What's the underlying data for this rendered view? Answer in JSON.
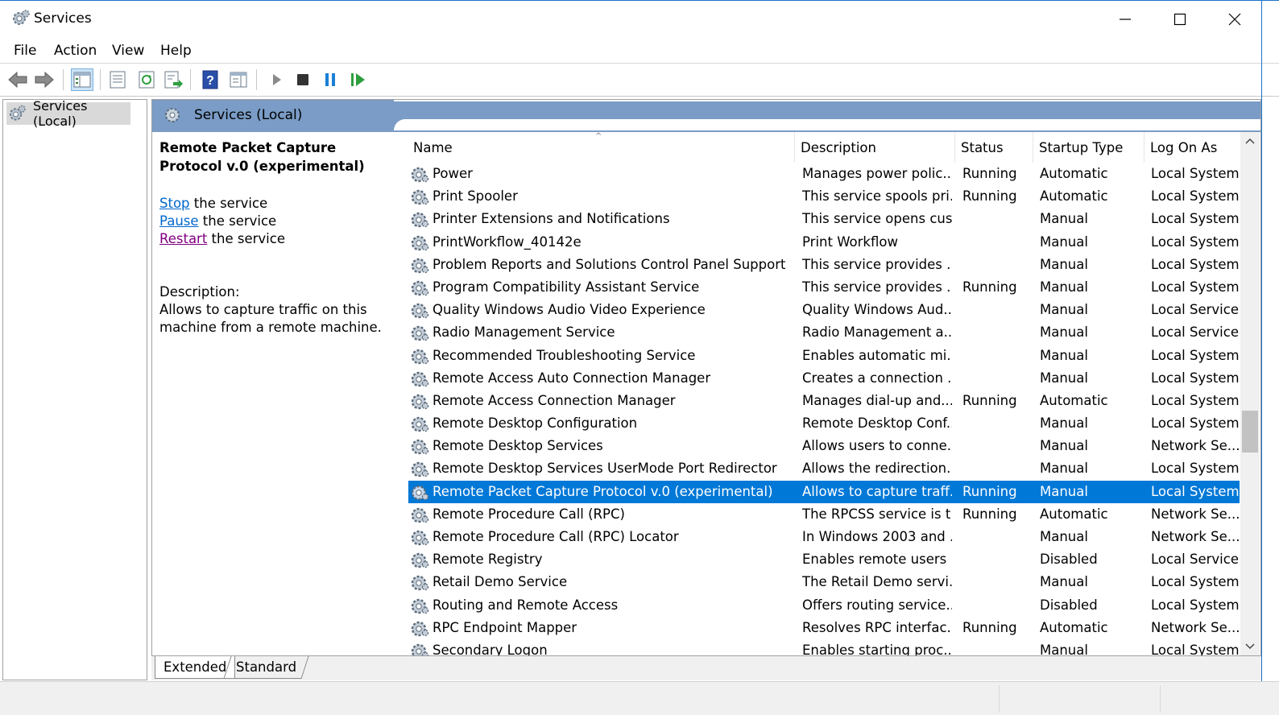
{
  "window": {
    "title": "Services",
    "icon": "services-gear-icon"
  },
  "menu": {
    "items": [
      "File",
      "Action",
      "View",
      "Help"
    ]
  },
  "toolbar": {
    "icons": [
      "back-arrow-icon",
      "forward-arrow-icon",
      "show-hide-console-tree-icon",
      "properties-icon",
      "refresh-icon",
      "export-list-icon",
      "help-icon",
      "show-action-pane-icon",
      "start-service-icon",
      "stop-service-icon",
      "pause-service-icon",
      "restart-service-icon"
    ]
  },
  "tree": {
    "item": "Services (Local)"
  },
  "pane": {
    "header": "Services (Local)"
  },
  "details": {
    "title": "Remote Packet Capture Protocol v.0 (experimental)",
    "actions": [
      {
        "link": "Stop",
        "rest": " the service"
      },
      {
        "link": "Pause",
        "rest": " the service"
      },
      {
        "link": "Restart",
        "rest": " the service"
      }
    ],
    "description_label": "Description:",
    "description_text": "Allows to capture traffic on this machine from a remote machine."
  },
  "table": {
    "columns": [
      "Name",
      "Description",
      "Status",
      "Startup Type",
      "Log On As"
    ],
    "rows": [
      {
        "name": "Power",
        "description": "Manages power polic...",
        "status": "Running",
        "startup": "Automatic",
        "logon": "Local System"
      },
      {
        "name": "Print Spooler",
        "description": "This service spools pri...",
        "status": "Running",
        "startup": "Automatic",
        "logon": "Local System"
      },
      {
        "name": "Printer Extensions and Notifications",
        "description": "This service opens cus...",
        "status": "",
        "startup": "Manual",
        "logon": "Local System"
      },
      {
        "name": "PrintWorkflow_40142e",
        "description": "Print Workflow",
        "status": "",
        "startup": "Manual",
        "logon": "Local System"
      },
      {
        "name": "Problem Reports and Solutions Control Panel Support",
        "description": "This service provides ...",
        "status": "",
        "startup": "Manual",
        "logon": "Local System"
      },
      {
        "name": "Program Compatibility Assistant Service",
        "description": "This service provides ...",
        "status": "Running",
        "startup": "Manual",
        "logon": "Local System"
      },
      {
        "name": "Quality Windows Audio Video Experience",
        "description": "Quality Windows Aud...",
        "status": "",
        "startup": "Manual",
        "logon": "Local Service"
      },
      {
        "name": "Radio Management Service",
        "description": "Radio Management a...",
        "status": "",
        "startup": "Manual",
        "logon": "Local Service"
      },
      {
        "name": "Recommended Troubleshooting Service",
        "description": "Enables automatic mi...",
        "status": "",
        "startup": "Manual",
        "logon": "Local System"
      },
      {
        "name": "Remote Access Auto Connection Manager",
        "description": "Creates a connection ...",
        "status": "",
        "startup": "Manual",
        "logon": "Local System"
      },
      {
        "name": "Remote Access Connection Manager",
        "description": "Manages dial-up and...",
        "status": "Running",
        "startup": "Automatic",
        "logon": "Local System"
      },
      {
        "name": "Remote Desktop Configuration",
        "description": "Remote Desktop Conf...",
        "status": "",
        "startup": "Manual",
        "logon": "Local System"
      },
      {
        "name": "Remote Desktop Services",
        "description": "Allows users to conne...",
        "status": "",
        "startup": "Manual",
        "logon": "Network Se..."
      },
      {
        "name": "Remote Desktop Services UserMode Port Redirector",
        "description": "Allows the redirection...",
        "status": "",
        "startup": "Manual",
        "logon": "Local System"
      },
      {
        "name": "Remote Packet Capture Protocol v.0 (experimental)",
        "description": "Allows to capture traff...",
        "status": "Running",
        "startup": "Manual",
        "logon": "Local System",
        "selected": true
      },
      {
        "name": "Remote Procedure Call (RPC)",
        "description": "The RPCSS service is t...",
        "status": "Running",
        "startup": "Automatic",
        "logon": "Network Se..."
      },
      {
        "name": "Remote Procedure Call (RPC) Locator",
        "description": "In Windows 2003 and ...",
        "status": "",
        "startup": "Manual",
        "logon": "Network Se..."
      },
      {
        "name": "Remote Registry",
        "description": "Enables remote users ...",
        "status": "",
        "startup": "Disabled",
        "logon": "Local Service"
      },
      {
        "name": "Retail Demo Service",
        "description": "The Retail Demo servi...",
        "status": "",
        "startup": "Manual",
        "logon": "Local System"
      },
      {
        "name": "Routing and Remote Access",
        "description": "Offers routing service...",
        "status": "",
        "startup": "Disabled",
        "logon": "Local System"
      },
      {
        "name": "RPC Endpoint Mapper",
        "description": "Resolves RPC interfac...",
        "status": "Running",
        "startup": "Automatic",
        "logon": "Network Se..."
      },
      {
        "name": "Secondary Logon",
        "description": "Enables starting proc...",
        "status": "",
        "startup": "Manual",
        "logon": "Local System"
      }
    ]
  },
  "tabs": [
    "Extended",
    "Standard"
  ],
  "colors": {
    "selection": "#0078d7",
    "header_band": "#7a9cc6",
    "link": "#0066cc",
    "visited_link": "#800080"
  }
}
